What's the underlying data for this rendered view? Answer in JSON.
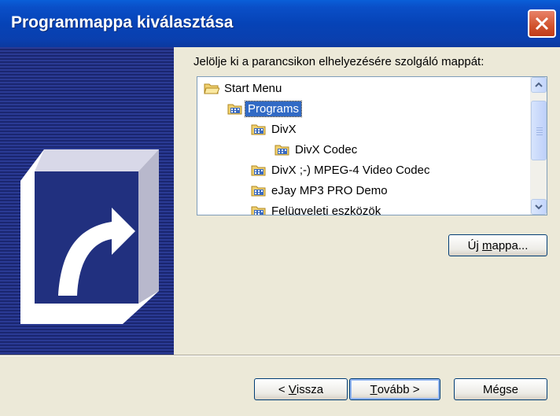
{
  "window": {
    "title": "Programmappa kiválasztása"
  },
  "instruction": "Jelölje ki a parancsikon elhelyezésére szolgáló mappát:",
  "tree": {
    "items": [
      {
        "label": "Start Menu",
        "level": 0,
        "selected": false
      },
      {
        "label": "Programs",
        "level": 1,
        "selected": true
      },
      {
        "label": "DivX",
        "level": 2,
        "selected": false
      },
      {
        "label": "DivX Codec",
        "level": 3,
        "selected": false
      },
      {
        "label": "DivX ;-) MPEG-4 Video Codec",
        "level": 2,
        "selected": false
      },
      {
        "label": "eJay MP3 PRO Demo",
        "level": 2,
        "selected": false
      },
      {
        "label": "Felügyeleti eszközök",
        "level": 2,
        "selected": false
      }
    ]
  },
  "buttons": {
    "new_folder_pre": "Új ",
    "new_folder_u": "m",
    "new_folder_post": "appa...",
    "back_pre": "< ",
    "back_u": "V",
    "back_post": "issza",
    "next_u": "T",
    "next_post": "ovább >",
    "cancel": "Mégse"
  },
  "colors": {
    "titlebar": "#0a4fc8",
    "selection": "#316ac5",
    "side_panel": "#21307f"
  }
}
